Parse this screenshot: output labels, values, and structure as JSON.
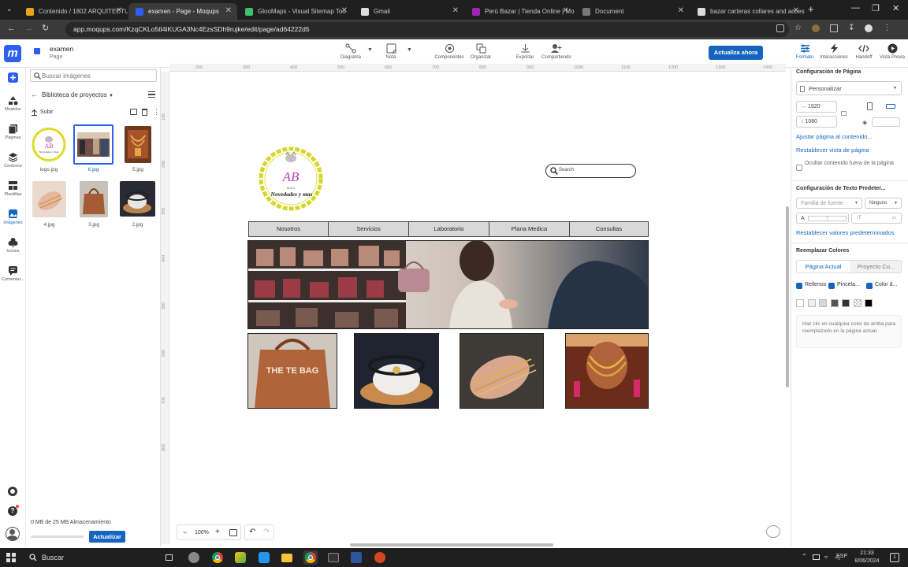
{
  "browser": {
    "tabs": [
      {
        "title": "Contenido / 1802 ARQUITECTU",
        "color": "#e8a317",
        "active": false
      },
      {
        "title": "examen - Page - Moqups",
        "color": "#2d5ff0",
        "active": true
      },
      {
        "title": "GlooMaps - Visual Sitemap Too",
        "color": "#3ec06c",
        "active": false
      },
      {
        "title": "Gmail",
        "color": "#dddddd",
        "active": false
      },
      {
        "title": "Perú Bazar | Tienda Online | Mo",
        "color": "#9c27b0",
        "active": false
      },
      {
        "title": "Document",
        "color": "#777777",
        "active": false
      },
      {
        "title": "bazar carteras collares and acceso",
        "color": "#dddddd",
        "active": false
      }
    ],
    "url": "app.moqups.com/KzqCKLo5tI4iKUGA3Nc4EzsSDh9rujke/edit/page/ad64222d5"
  },
  "header": {
    "logo": "m",
    "project_title": "examen",
    "page_subtitle": "Page",
    "tools": [
      {
        "label": "Diagrama",
        "icon": "diagram-icon"
      },
      {
        "label": "Nota",
        "icon": "note-icon"
      },
      {
        "label": "Componentes",
        "icon": "components-icon"
      },
      {
        "label": "Organizar",
        "icon": "arrange-icon"
      },
      {
        "label": "Exportar",
        "icon": "export-icon"
      },
      {
        "label": "Compartiendo",
        "icon": "share-icon"
      }
    ],
    "update_button": "Actualiza ahora",
    "right_tools": [
      {
        "label": "Formato",
        "icon": "format-icon",
        "active": true
      },
      {
        "label": "Interacciones",
        "icon": "bolt-icon",
        "active": false
      },
      {
        "label": "Handoff",
        "icon": "code-icon",
        "active": false
      },
      {
        "label": "Vista Previa",
        "icon": "play-icon",
        "active": false
      }
    ]
  },
  "rail": {
    "items": [
      {
        "label": "",
        "icon": "add-icon"
      },
      {
        "label": "Modelos",
        "icon": "shapes-icon"
      },
      {
        "label": "Páginas",
        "icon": "pages-icon"
      },
      {
        "label": "Contorno",
        "icon": "layers-icon"
      },
      {
        "label": "Plantillas",
        "icon": "templates-icon"
      },
      {
        "label": "Imágenes",
        "icon": "images-icon"
      },
      {
        "label": "Iconos",
        "icon": "icons-icon"
      },
      {
        "label": "Comentar...",
        "icon": "comment-icon"
      }
    ]
  },
  "images_panel": {
    "search_placeholder": "Buscar imágenes",
    "library_label": "Biblioteca de proyectos",
    "upload_label": "Subir",
    "images": [
      {
        "name": "logo.jpg",
        "selected": false
      },
      {
        "name": "6.jpg",
        "selected": true
      },
      {
        "name": "5.jpg",
        "selected": false
      },
      {
        "name": "4.jpg",
        "selected": false
      },
      {
        "name": "3.jpg",
        "selected": false
      },
      {
        "name": "2.jpg",
        "selected": false
      }
    ],
    "storage_text": "0 MB de 25 MB Almacenamiento",
    "storage_used_fraction": 0,
    "upgrade_button": "Actualizar"
  },
  "canvas": {
    "ruler_top": [
      "200",
      "300",
      "400",
      "500",
      "600",
      "700",
      "800",
      "900",
      "1000",
      "1100",
      "1200",
      "1300",
      "1400"
    ],
    "ruler_left": [
      "100",
      "200",
      "300",
      "400",
      "500",
      "600",
      "700",
      "800"
    ],
    "zoom": "100%",
    "mockup": {
      "logo_text": "Novedades y mas",
      "logo_initials": "AB",
      "search_placeholder": "Search",
      "nav": [
        "Nosotros",
        "Servicios",
        "Laboratorio",
        "Plana Medica",
        "Consultas"
      ],
      "product_bag_text": "THE TE BAG"
    }
  },
  "format_panel": {
    "page_config_title": "Configuración de Página",
    "size_preset": "Personalizar",
    "width": "1920",
    "height": "1080",
    "fit_link": "Ajustar página al contenido...",
    "reset_view_link": "Restablecer vista de página",
    "hide_outside_label": "Ocultar contenido fuera de la página",
    "text_config_title": "Configuración de Texto Predeter...",
    "font_family_placeholder": "Familia de fuente",
    "font_style": "Ninguno",
    "font_size_placeholder": "?",
    "reset_defaults_link": "Restablecer valores predeterminados",
    "replace_colors_title": "Reemplazar Colores",
    "tabs": [
      "Página Actual",
      "Proyecto Co..."
    ],
    "checks": [
      "Rellenos",
      "Pincela...",
      "Color d..."
    ],
    "swatches": [
      "#ffffff",
      "#eeeeee",
      "#d6d6d6",
      "#555555",
      "#333333",
      "transparent",
      "#000000"
    ],
    "hint": "Haz clic en cualquier color de arriba para reemplazarlo en la página actual"
  },
  "taskbar": {
    "search": "Buscar",
    "lang": "ESP",
    "time": "21:33",
    "date": "8/06/2024",
    "notif_count": "1"
  }
}
